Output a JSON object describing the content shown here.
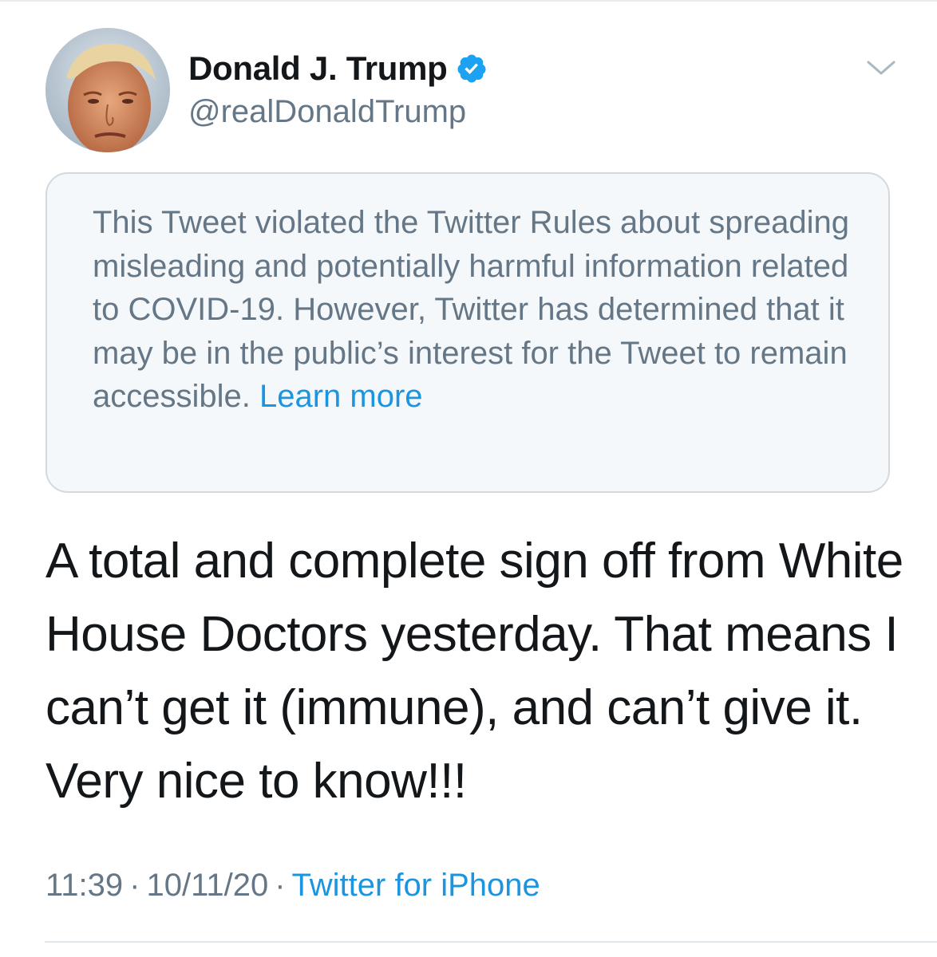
{
  "tweet": {
    "author": {
      "display_name": "Donald J. Trump",
      "handle": "@realDonaldTrump",
      "verified": true
    },
    "notice": {
      "text": "This Tweet violated the Twitter Rules about spreading misleading and potentially harmful information related to COVID-19. However, Twitter has determined that it may be in the public’s interest for the Tweet to remain accessible.",
      "link_label": "Learn more"
    },
    "body": "A total and complete sign off from White House Doctors yesterday. That means I can’t get it (immune), and can’t give it. Very nice to know!!!",
    "meta": {
      "time": "11:39",
      "date": "10/11/20",
      "separator": "·",
      "source": "Twitter for iPhone"
    }
  },
  "icons": {
    "verified": "verified-badge-icon",
    "menu": "chevron-down-icon",
    "avatar": "profile-avatar"
  },
  "colors": {
    "link": "#1b95e0",
    "secondary_text": "#657786",
    "primary_text": "#14171a",
    "notice_background": "#f5f8fa",
    "verified": "#1da1f2"
  }
}
